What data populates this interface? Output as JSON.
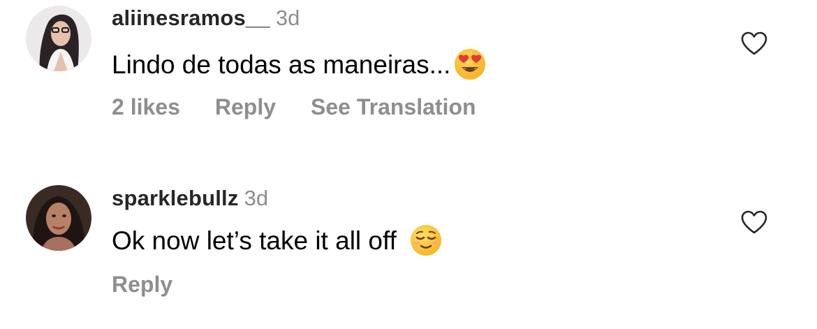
{
  "comments": [
    {
      "username": "aliinesramos__",
      "time": "3d",
      "text": "Lindo de todas as maneiras...",
      "emoji": "heart-eyes-emoji",
      "actions": {
        "likes": "2 likes",
        "reply": "Reply",
        "translate": "See Translation"
      }
    },
    {
      "username": "sparklebullz",
      "time": "3d",
      "text": "Ok now let’s take it all off",
      "emoji": "relieved-face-emoji",
      "actions": {
        "reply": "Reply"
      }
    }
  ],
  "colors": {
    "username": "#262626",
    "meta": "#8e8e8e",
    "text": "#000000",
    "background": "#ffffff"
  },
  "icons": {
    "like": "heart-outline-icon"
  }
}
